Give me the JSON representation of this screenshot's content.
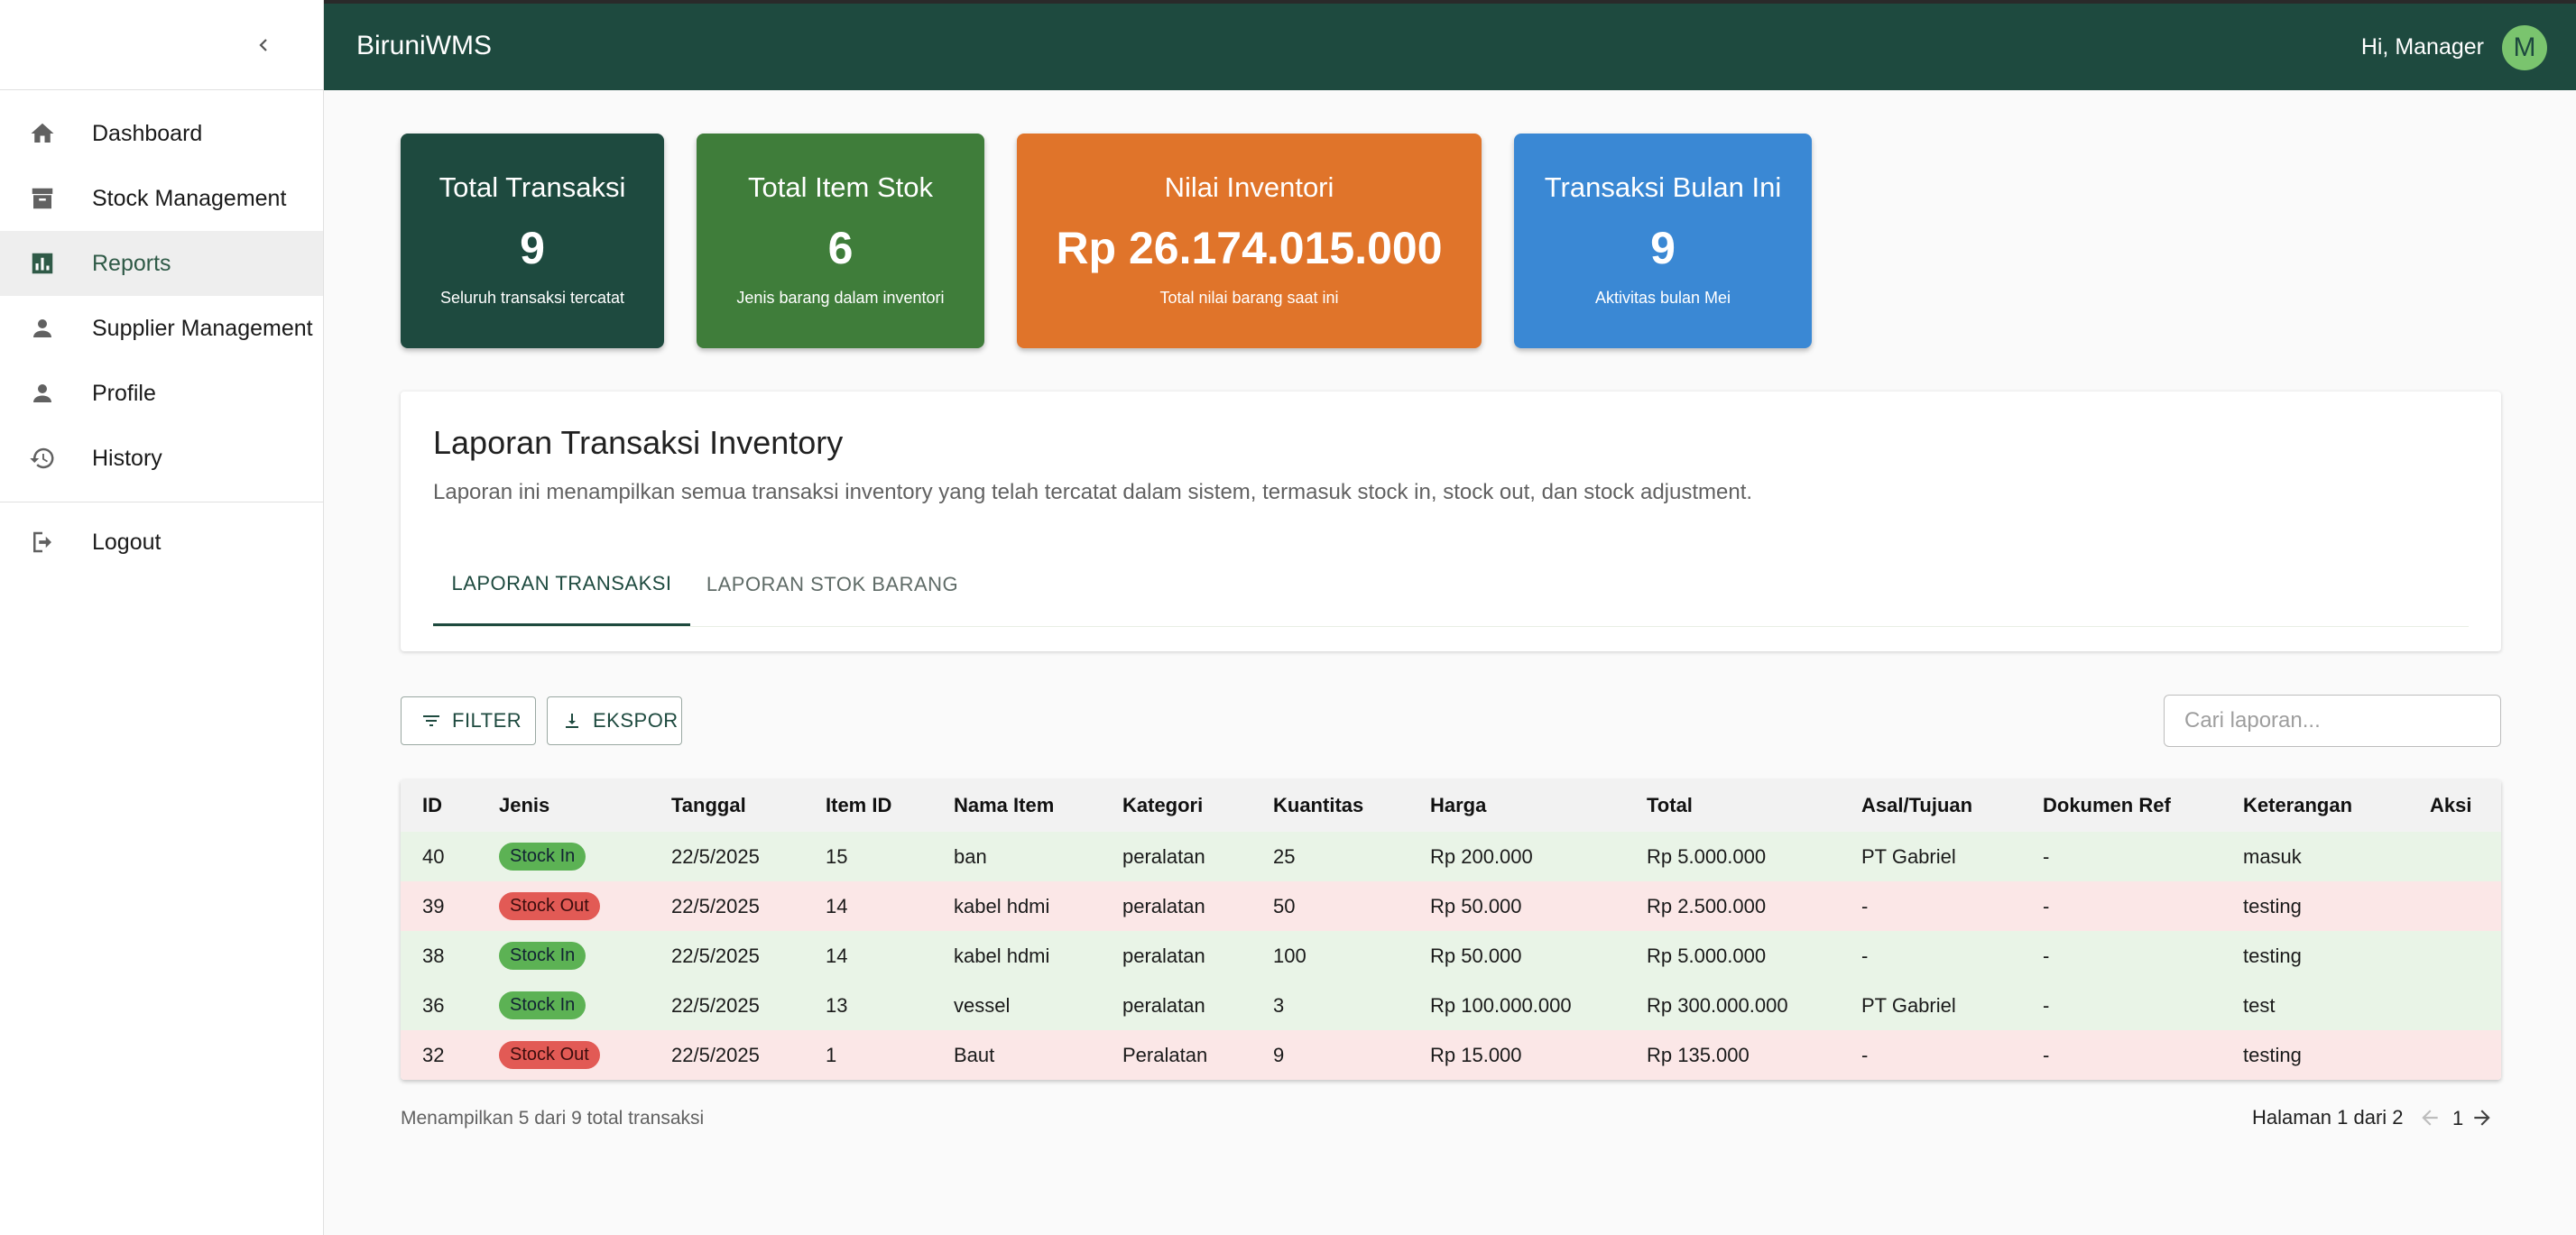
{
  "app": {
    "title": "BiruniWMS",
    "greeting": "Hi, Manager",
    "avatar_initial": "M"
  },
  "sidebar": {
    "items": [
      {
        "label": "Dashboard",
        "icon": "home-icon"
      },
      {
        "label": "Stock Management",
        "icon": "archive-icon"
      },
      {
        "label": "Reports",
        "icon": "bar-chart-icon",
        "active": true
      },
      {
        "label": "Supplier Management",
        "icon": "person-icon"
      },
      {
        "label": "Profile",
        "icon": "person-icon"
      },
      {
        "label": "History",
        "icon": "history-icon"
      }
    ],
    "logout": "Logout"
  },
  "cards": [
    {
      "title": "Total Transaksi",
      "value": "9",
      "sub": "Seluruh transaksi tercatat",
      "color": "#1e4a3f"
    },
    {
      "title": "Total Item Stok",
      "value": "6",
      "sub": "Jenis barang dalam inventori",
      "color": "#3f7d3a"
    },
    {
      "title": "Nilai Inventori",
      "value": "Rp 26.174.015.000",
      "sub": "Total nilai barang saat ini",
      "color": "#e0742a"
    },
    {
      "title": "Transaksi Bulan Ini",
      "value": "9",
      "sub": "Aktivitas bulan Mei",
      "color": "#3a88d4"
    }
  ],
  "report": {
    "title": "Laporan Transaksi Inventory",
    "description": "Laporan ini menampilkan semua transaksi inventory yang telah tercatat dalam sistem, termasuk stock in, stock out, dan stock adjustment.",
    "tabs": [
      "LAPORAN TRANSAKSI",
      "LAPORAN STOK BARANG"
    ]
  },
  "toolbar": {
    "filter_label": "FILTER",
    "export_label": "EKSPOR",
    "search_placeholder": "Cari laporan..."
  },
  "table": {
    "headers": [
      "ID",
      "Jenis",
      "Tanggal",
      "Item ID",
      "Nama Item",
      "Kategori",
      "Kuantitas",
      "Harga",
      "Total",
      "Asal/Tujuan",
      "Dokumen Ref",
      "Keterangan",
      "Aksi"
    ],
    "rows": [
      {
        "type": "in",
        "cells": [
          "40",
          "Stock In",
          "22/5/2025",
          "15",
          "ban",
          "peralatan",
          "25",
          "Rp 200.000",
          "Rp 5.000.000",
          "PT Gabriel",
          "-",
          "masuk",
          ""
        ]
      },
      {
        "type": "out",
        "cells": [
          "39",
          "Stock Out",
          "22/5/2025",
          "14",
          "kabel hdmi",
          "peralatan",
          "50",
          "Rp 50.000",
          "Rp 2.500.000",
          "-",
          "-",
          "testing",
          ""
        ]
      },
      {
        "type": "in",
        "cells": [
          "38",
          "Stock In",
          "22/5/2025",
          "14",
          "kabel hdmi",
          "peralatan",
          "100",
          "Rp 50.000",
          "Rp 5.000.000",
          "-",
          "-",
          "testing",
          ""
        ]
      },
      {
        "type": "in",
        "cells": [
          "36",
          "Stock In",
          "22/5/2025",
          "13",
          "vessel",
          "peralatan",
          "3",
          "Rp 100.000.000",
          "Rp 300.000.000",
          "PT Gabriel",
          "-",
          "test",
          ""
        ]
      },
      {
        "type": "out",
        "cells": [
          "32",
          "Stock Out",
          "22/5/2025",
          "1",
          "Baut",
          "Peralatan",
          "9",
          "Rp 15.000",
          "Rp 135.000",
          "-",
          "-",
          "testing",
          ""
        ]
      }
    ]
  },
  "footer": {
    "summary": "Menampilkan 5 dari 9 total transaksi",
    "page_label": "Halaman 1 dari 2",
    "page_number": "1"
  }
}
